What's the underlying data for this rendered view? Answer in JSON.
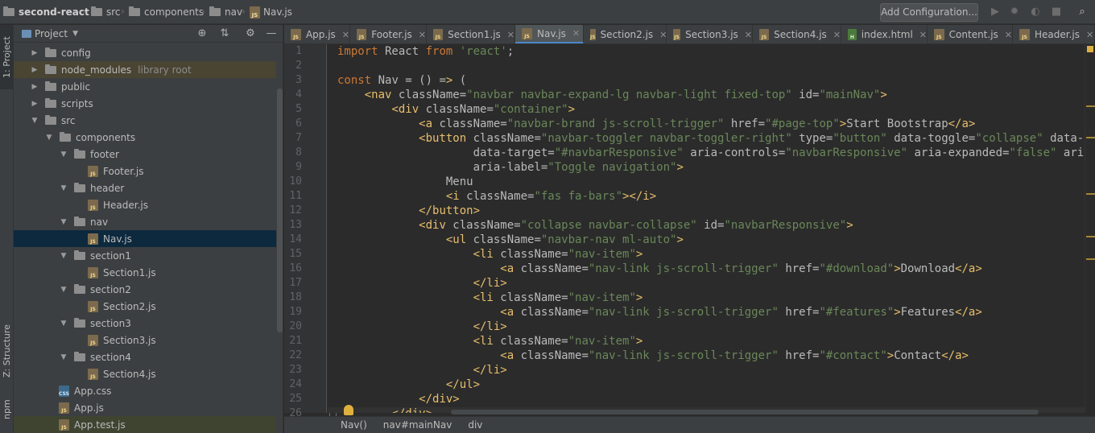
{
  "navbar": {
    "breadcrumbs": [
      "second-react",
      "src",
      "components",
      "nav",
      "Nav.js"
    ],
    "add_configuration": "Add Configuration...",
    "icons": [
      "run-icon",
      "debug-icon",
      "coverage-icon",
      "stop-icon",
      "search-icon"
    ]
  },
  "stripe": {
    "project_tab": "1: Project",
    "structure_tab": "Z: Structure",
    "npm_tab": "npm"
  },
  "project": {
    "title": "Project",
    "items": [
      {
        "label": "config",
        "type": "dir",
        "arrow": "▶",
        "depth": 0
      },
      {
        "label": "node_modules",
        "extra": "library root",
        "type": "dir",
        "arrow": "▶",
        "depth": 0
      },
      {
        "label": "public",
        "type": "dir",
        "arrow": "▶",
        "depth": 0
      },
      {
        "label": "scripts",
        "type": "dir",
        "arrow": "▶",
        "depth": 0
      },
      {
        "label": "src",
        "type": "dir",
        "arrow": "▼",
        "depth": 0
      },
      {
        "label": "components",
        "type": "dir",
        "arrow": "▼",
        "depth": 1
      },
      {
        "label": "footer",
        "type": "dir",
        "arrow": "▼",
        "depth": 2
      },
      {
        "label": "Footer.js",
        "type": "js",
        "depth": 3
      },
      {
        "label": "header",
        "type": "dir",
        "arrow": "▼",
        "depth": 2
      },
      {
        "label": "Header.js",
        "type": "js",
        "depth": 3
      },
      {
        "label": "nav",
        "type": "dir",
        "arrow": "▼",
        "depth": 2
      },
      {
        "label": "Nav.js",
        "type": "js",
        "depth": 3
      },
      {
        "label": "section1",
        "type": "dir",
        "arrow": "▼",
        "depth": 2
      },
      {
        "label": "Section1.js",
        "type": "js",
        "depth": 3
      },
      {
        "label": "section2",
        "type": "dir",
        "arrow": "▼",
        "depth": 2
      },
      {
        "label": "Section2.js",
        "type": "js",
        "depth": 3
      },
      {
        "label": "section3",
        "type": "dir",
        "arrow": "▼",
        "depth": 2
      },
      {
        "label": "Section3.js",
        "type": "js",
        "depth": 3
      },
      {
        "label": "section4",
        "type": "dir",
        "arrow": "▼",
        "depth": 2
      },
      {
        "label": "Section4.js",
        "type": "js",
        "depth": 3
      },
      {
        "label": "App.css",
        "type": "css",
        "depth": 1
      },
      {
        "label": "App.js",
        "type": "js",
        "depth": 1
      },
      {
        "label": "App.test.js",
        "type": "js",
        "depth": 1
      }
    ]
  },
  "tabs": [
    "App.js",
    "Footer.js",
    "Section1.js",
    "Nav.js",
    "Section2.js",
    "Section3.js",
    "Section4.js",
    "index.html",
    "Content.js",
    "Header.js"
  ],
  "editor": {
    "line_numbers": [
      "1",
      "2",
      "3",
      "4",
      "5",
      "6",
      "7",
      "8",
      "9",
      "10",
      "11",
      "12",
      "13",
      "14",
      "15",
      "16",
      "17",
      "18",
      "19",
      "20",
      "21",
      "22",
      "23",
      "24",
      "25",
      "26"
    ],
    "lines": [
      "import React from 'react';",
      "",
      "const Nav = () => (",
      "    <nav className=\"navbar navbar-expand-lg navbar-light fixed-top\" id=\"mainNav\">",
      "        <div className=\"container\">",
      "            <a className=\"navbar-brand js-scroll-trigger\" href=\"#page-top\">Start Bootstrap</a>",
      "            <button className=\"navbar-toggler navbar-toggler-right\" type=\"button\" data-toggle=\"collapse\" data-target",
      "                    data-target=\"#navbarResponsive\" aria-controls=\"navbarResponsive\" aria-expanded=\"false\" ari",
      "                    aria-label=\"Toggle navigation\">",
      "                Menu",
      "                <i className=\"fas fa-bars\"></i>",
      "            </button>",
      "            <div className=\"collapse navbar-collapse\" id=\"navbarResponsive\">",
      "                <ul className=\"navbar-nav ml-auto\">",
      "                    <li className=\"nav-item\">",
      "                        <a className=\"nav-link js-scroll-trigger\" href=\"#download\">Download</a>",
      "                    </li>",
      "                    <li className=\"nav-item\">",
      "                        <a className=\"nav-link js-scroll-trigger\" href=\"#features\">Features</a>",
      "                    </li>",
      "                    <li className=\"nav-item\">",
      "                        <a className=\"nav-link js-scroll-trigger\" href=\"#contact\">Contact</a>",
      "                    </li>",
      "                </ul>",
      "            </div>",
      "        </div>"
    ]
  },
  "status": {
    "breadcrumb": [
      "Nav()",
      "nav#mainNav",
      "div"
    ]
  },
  "colors": {
    "keyword": "#cc7832",
    "string": "#6a8759",
    "tag": "#e8bf6a",
    "selection": "#0d293e",
    "accent": "#4a88c7"
  }
}
